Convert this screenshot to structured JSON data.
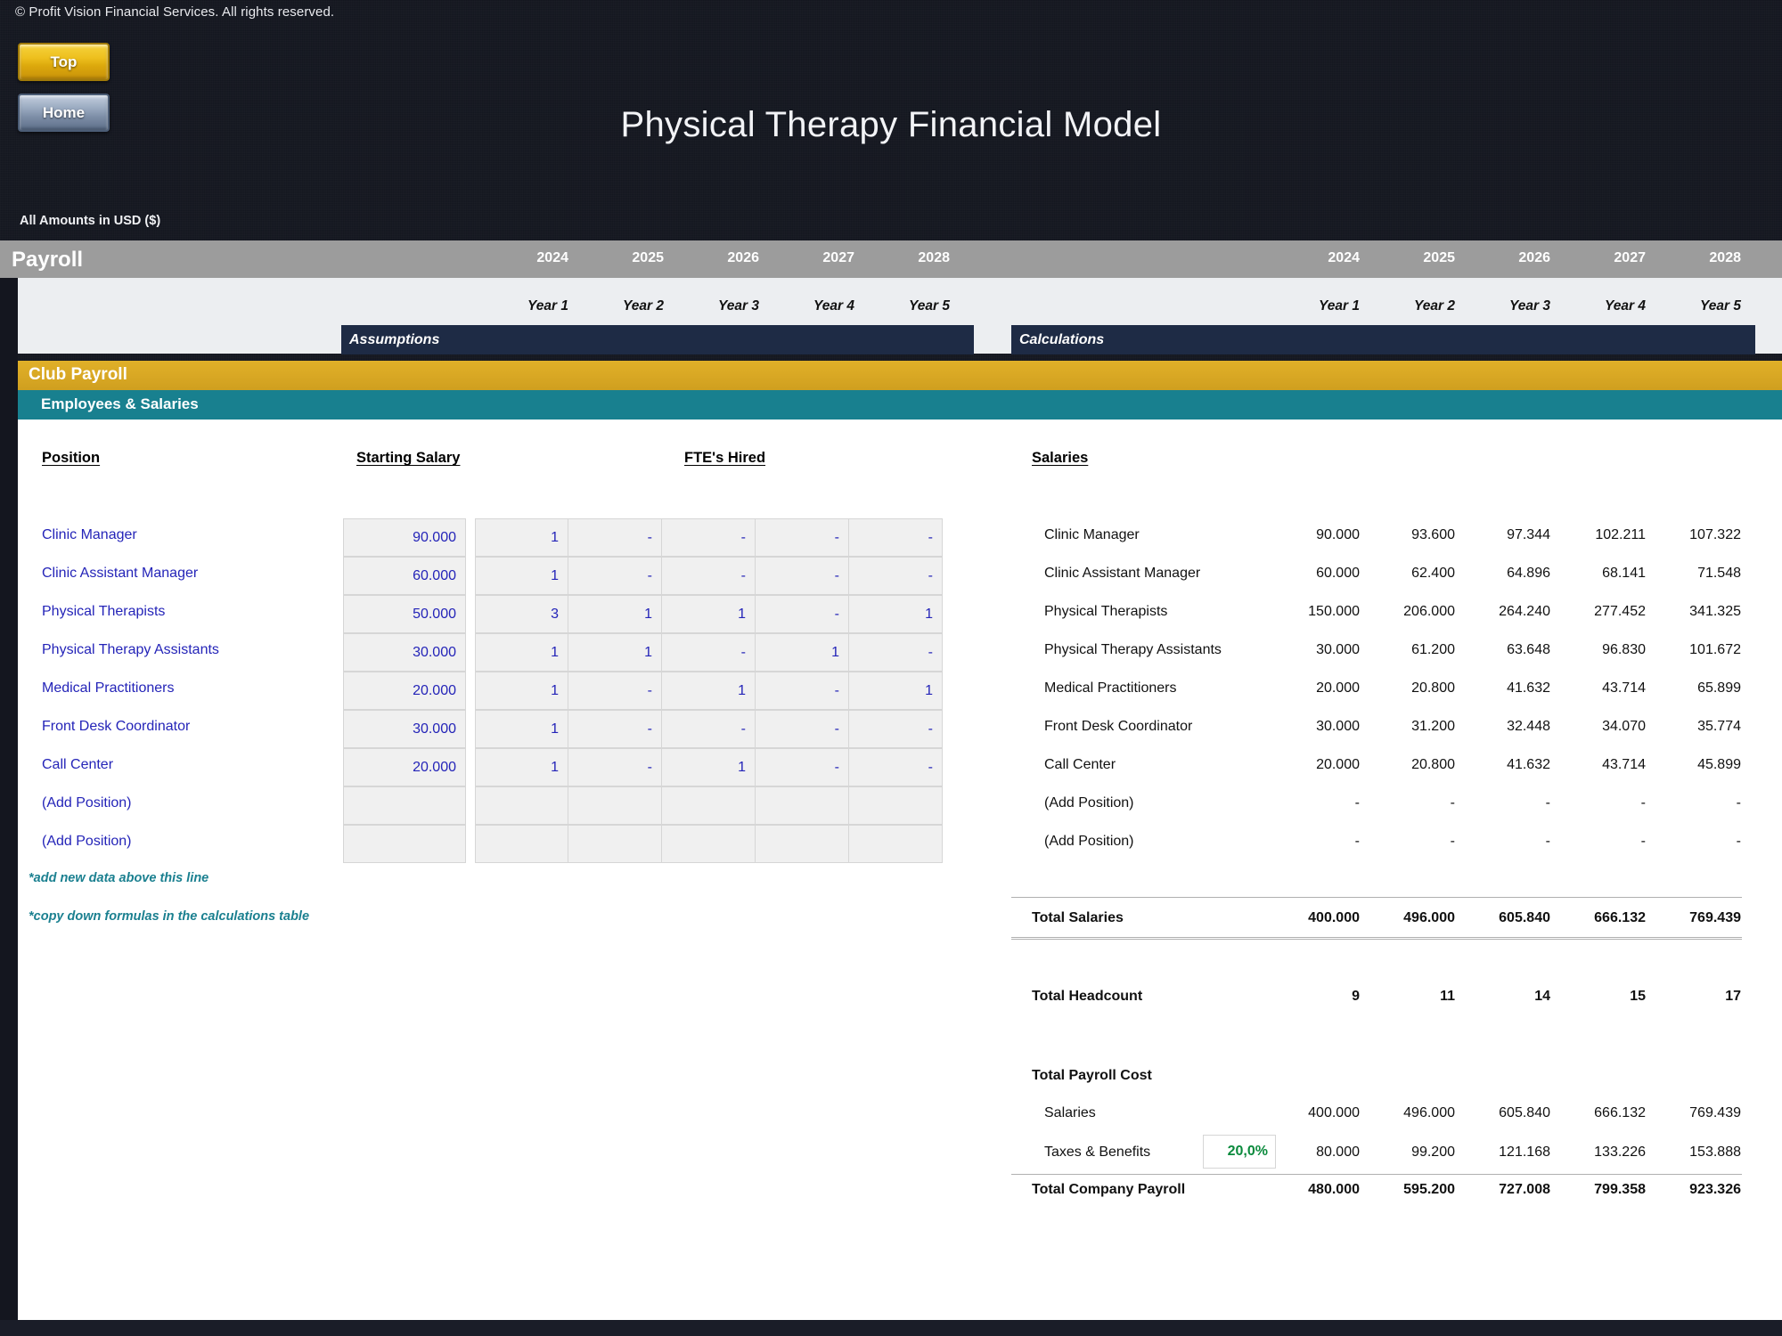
{
  "window": {
    "copyright": "© Profit Vision Financial Services. All rights reserved.",
    "title": "Physical Therapy Financial Model",
    "currency_note": "All Amounts in  USD ($)"
  },
  "nav": {
    "top_label": "Top",
    "home_label": "Home"
  },
  "header": {
    "section_title": "Payroll",
    "years": [
      "2024",
      "2025",
      "2026",
      "2027",
      "2028"
    ],
    "year_labels": [
      "Year 1",
      "Year 2",
      "Year 3",
      "Year 4",
      "Year 5"
    ]
  },
  "bands": {
    "assumptions": "Assumptions",
    "calculations": "Calculations",
    "club_payroll": "Club Payroll",
    "employees_salaries": "Employees & Salaries"
  },
  "assumptions": {
    "col_position": "Position",
    "col_starting_salary": "Starting Salary",
    "col_fte_hired": "FTE's Hired",
    "rows": [
      {
        "position": "Clinic Manager",
        "starting_salary": "90.000",
        "fte": [
          "1",
          "-",
          "-",
          "-",
          "-"
        ]
      },
      {
        "position": "Clinic Assistant Manager",
        "starting_salary": "60.000",
        "fte": [
          "1",
          "-",
          "-",
          "-",
          "-"
        ]
      },
      {
        "position": "Physical Therapists",
        "starting_salary": "50.000",
        "fte": [
          "3",
          "1",
          "1",
          "-",
          "1"
        ]
      },
      {
        "position": "Physical Therapy Assistants",
        "starting_salary": "30.000",
        "fte": [
          "1",
          "1",
          "-",
          "1",
          "-"
        ]
      },
      {
        "position": "Medical Practitioners",
        "starting_salary": "20.000",
        "fte": [
          "1",
          "-",
          "1",
          "-",
          "1"
        ]
      },
      {
        "position": "Front Desk Coordinator",
        "starting_salary": "30.000",
        "fte": [
          "1",
          "-",
          "-",
          "-",
          "-"
        ]
      },
      {
        "position": "Call Center",
        "starting_salary": "20.000",
        "fte": [
          "1",
          "-",
          "1",
          "-",
          "-"
        ]
      },
      {
        "position": "(Add Position)",
        "starting_salary": "",
        "fte": [
          "",
          "",
          "",
          "",
          ""
        ]
      },
      {
        "position": "(Add Position)",
        "starting_salary": "",
        "fte": [
          "",
          "",
          "",
          "",
          ""
        ]
      }
    ],
    "notes": [
      "*add new data above this line",
      "*copy down formulas in the calculations table"
    ]
  },
  "calculations": {
    "col_salaries": "Salaries",
    "rows": [
      {
        "position": "Clinic Manager",
        "values": [
          "90.000",
          "93.600",
          "97.344",
          "102.211",
          "107.322"
        ]
      },
      {
        "position": "Clinic Assistant Manager",
        "values": [
          "60.000",
          "62.400",
          "64.896",
          "68.141",
          "71.548"
        ]
      },
      {
        "position": "Physical Therapists",
        "values": [
          "150.000",
          "206.000",
          "264.240",
          "277.452",
          "341.325"
        ]
      },
      {
        "position": "Physical Therapy Assistants",
        "values": [
          "30.000",
          "61.200",
          "63.648",
          "96.830",
          "101.672"
        ]
      },
      {
        "position": "Medical Practitioners",
        "values": [
          "20.000",
          "20.800",
          "41.632",
          "43.714",
          "65.899"
        ]
      },
      {
        "position": "Front Desk Coordinator",
        "values": [
          "30.000",
          "31.200",
          "32.448",
          "34.070",
          "35.774"
        ]
      },
      {
        "position": "Call Center",
        "values": [
          "20.000",
          "20.800",
          "41.632",
          "43.714",
          "45.899"
        ]
      },
      {
        "position": "(Add Position)",
        "values": [
          "-",
          "-",
          "-",
          "-",
          "-"
        ]
      },
      {
        "position": "(Add Position)",
        "values": [
          "-",
          "-",
          "-",
          "-",
          "-"
        ]
      }
    ],
    "total_salaries": {
      "label": "Total Salaries",
      "values": [
        "400.000",
        "496.000",
        "605.840",
        "666.132",
        "769.439"
      ]
    },
    "total_headcount": {
      "label": "Total Headcount",
      "values": [
        "9",
        "11",
        "14",
        "15",
        "17"
      ]
    },
    "payroll_cost": {
      "title": "Total Payroll Cost",
      "salaries_label": "Salaries",
      "salaries_values": [
        "400.000",
        "496.000",
        "605.840",
        "666.132",
        "769.439"
      ],
      "taxes_label": "Taxes & Benefits",
      "taxes_rate": "20,0%",
      "taxes_values": [
        "80.000",
        "99.200",
        "121.168",
        "133.226",
        "153.888"
      ],
      "total_label": "Total Company Payroll",
      "total_values": [
        "480.000",
        "595.200",
        "727.008",
        "799.358",
        "923.326"
      ]
    }
  },
  "colors": {
    "gold": "#d9a824",
    "teal": "#18808f",
    "navy": "#1e2b45",
    "grey_header": "#9c9c9c",
    "input_blue": "#2424b8",
    "percent_green": "#0a8a3c"
  }
}
